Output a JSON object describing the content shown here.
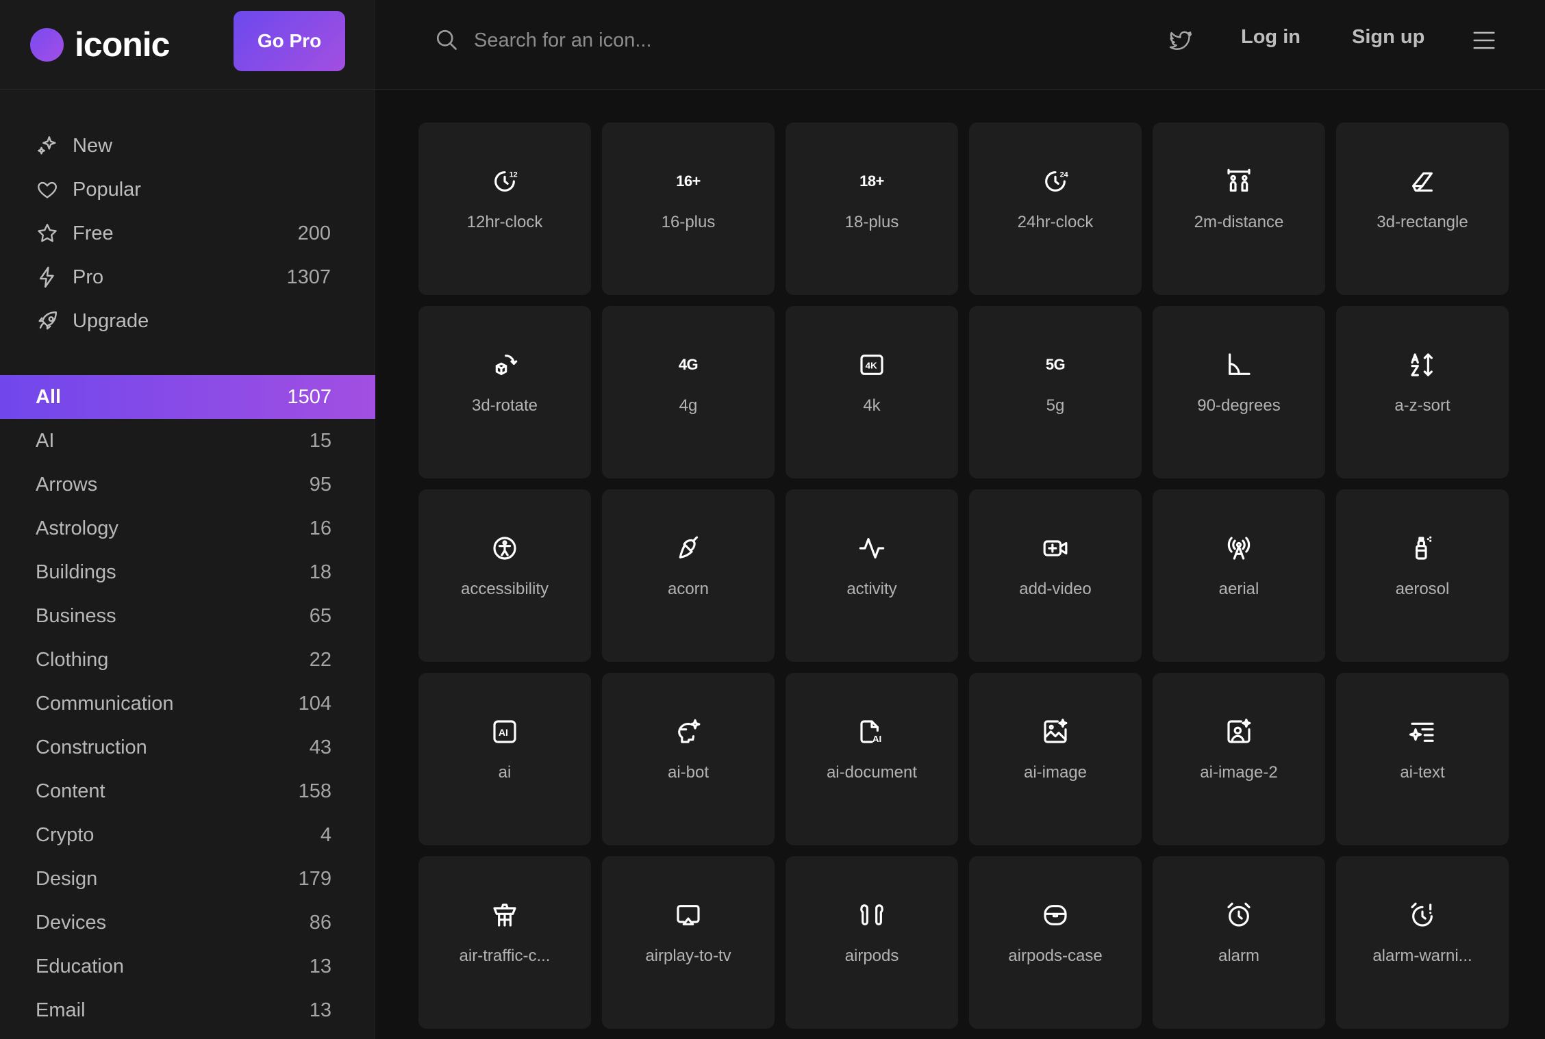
{
  "brand": {
    "name": "iconic",
    "cta": "Go Pro"
  },
  "header": {
    "search_placeholder": "Search for an icon...",
    "login": "Log in",
    "signup": "Sign up"
  },
  "quick": [
    {
      "label": "New",
      "count": "",
      "icon": "sparkles-icon"
    },
    {
      "label": "Popular",
      "count": "",
      "icon": "heart-icon"
    },
    {
      "label": "Free",
      "count": "200",
      "icon": "star-icon"
    },
    {
      "label": "Pro",
      "count": "1307",
      "icon": "lightning-icon"
    },
    {
      "label": "Upgrade",
      "count": "",
      "icon": "rocket-icon"
    }
  ],
  "categories": [
    {
      "label": "All",
      "count": "1507",
      "active": true
    },
    {
      "label": "AI",
      "count": "15"
    },
    {
      "label": "Arrows",
      "count": "95"
    },
    {
      "label": "Astrology",
      "count": "16"
    },
    {
      "label": "Buildings",
      "count": "18"
    },
    {
      "label": "Business",
      "count": "65"
    },
    {
      "label": "Clothing",
      "count": "22"
    },
    {
      "label": "Communication",
      "count": "104"
    },
    {
      "label": "Construction",
      "count": "43"
    },
    {
      "label": "Content",
      "count": "158"
    },
    {
      "label": "Crypto",
      "count": "4"
    },
    {
      "label": "Design",
      "count": "179"
    },
    {
      "label": "Devices",
      "count": "86"
    },
    {
      "label": "Education",
      "count": "13"
    },
    {
      "label": "Email",
      "count": "13"
    }
  ],
  "icons": [
    {
      "label": "12hr-clock",
      "glyph": "clock-12"
    },
    {
      "label": "16-plus",
      "glyph": "text",
      "text": "16+"
    },
    {
      "label": "18-plus",
      "glyph": "text",
      "text": "18+"
    },
    {
      "label": "24hr-clock",
      "glyph": "clock-24"
    },
    {
      "label": "2m-distance",
      "glyph": "distance"
    },
    {
      "label": "3d-rectangle",
      "glyph": "eraser"
    },
    {
      "label": "3d-rotate",
      "glyph": "cube-rotate"
    },
    {
      "label": "4g",
      "glyph": "text",
      "text": "4G"
    },
    {
      "label": "4k",
      "glyph": "box-4k",
      "text": "4K"
    },
    {
      "label": "5g",
      "glyph": "text",
      "text": "5G"
    },
    {
      "label": "90-degrees",
      "glyph": "angle"
    },
    {
      "label": "a-z-sort",
      "glyph": "az-sort"
    },
    {
      "label": "accessibility",
      "glyph": "accessibility"
    },
    {
      "label": "acorn",
      "glyph": "acorn"
    },
    {
      "label": "activity",
      "glyph": "activity"
    },
    {
      "label": "add-video",
      "glyph": "video"
    },
    {
      "label": "aerial",
      "glyph": "aerial"
    },
    {
      "label": "aerosol",
      "glyph": "aerosol"
    },
    {
      "label": "ai",
      "glyph": "ai-box",
      "text": "AI"
    },
    {
      "label": "ai-bot",
      "glyph": "ai-bot"
    },
    {
      "label": "ai-document",
      "glyph": "ai-document"
    },
    {
      "label": "ai-image",
      "glyph": "ai-image"
    },
    {
      "label": "ai-image-2",
      "glyph": "ai-image-2"
    },
    {
      "label": "ai-text",
      "glyph": "ai-text"
    },
    {
      "label": "air-traffic-c...",
      "glyph": "tower"
    },
    {
      "label": "airplay-to-tv",
      "glyph": "airplay"
    },
    {
      "label": "airpods",
      "glyph": "airpods"
    },
    {
      "label": "airpods-case",
      "glyph": "airpods-case"
    },
    {
      "label": "alarm",
      "glyph": "alarm"
    },
    {
      "label": "alarm-warni...",
      "glyph": "alarm-warning"
    }
  ]
}
